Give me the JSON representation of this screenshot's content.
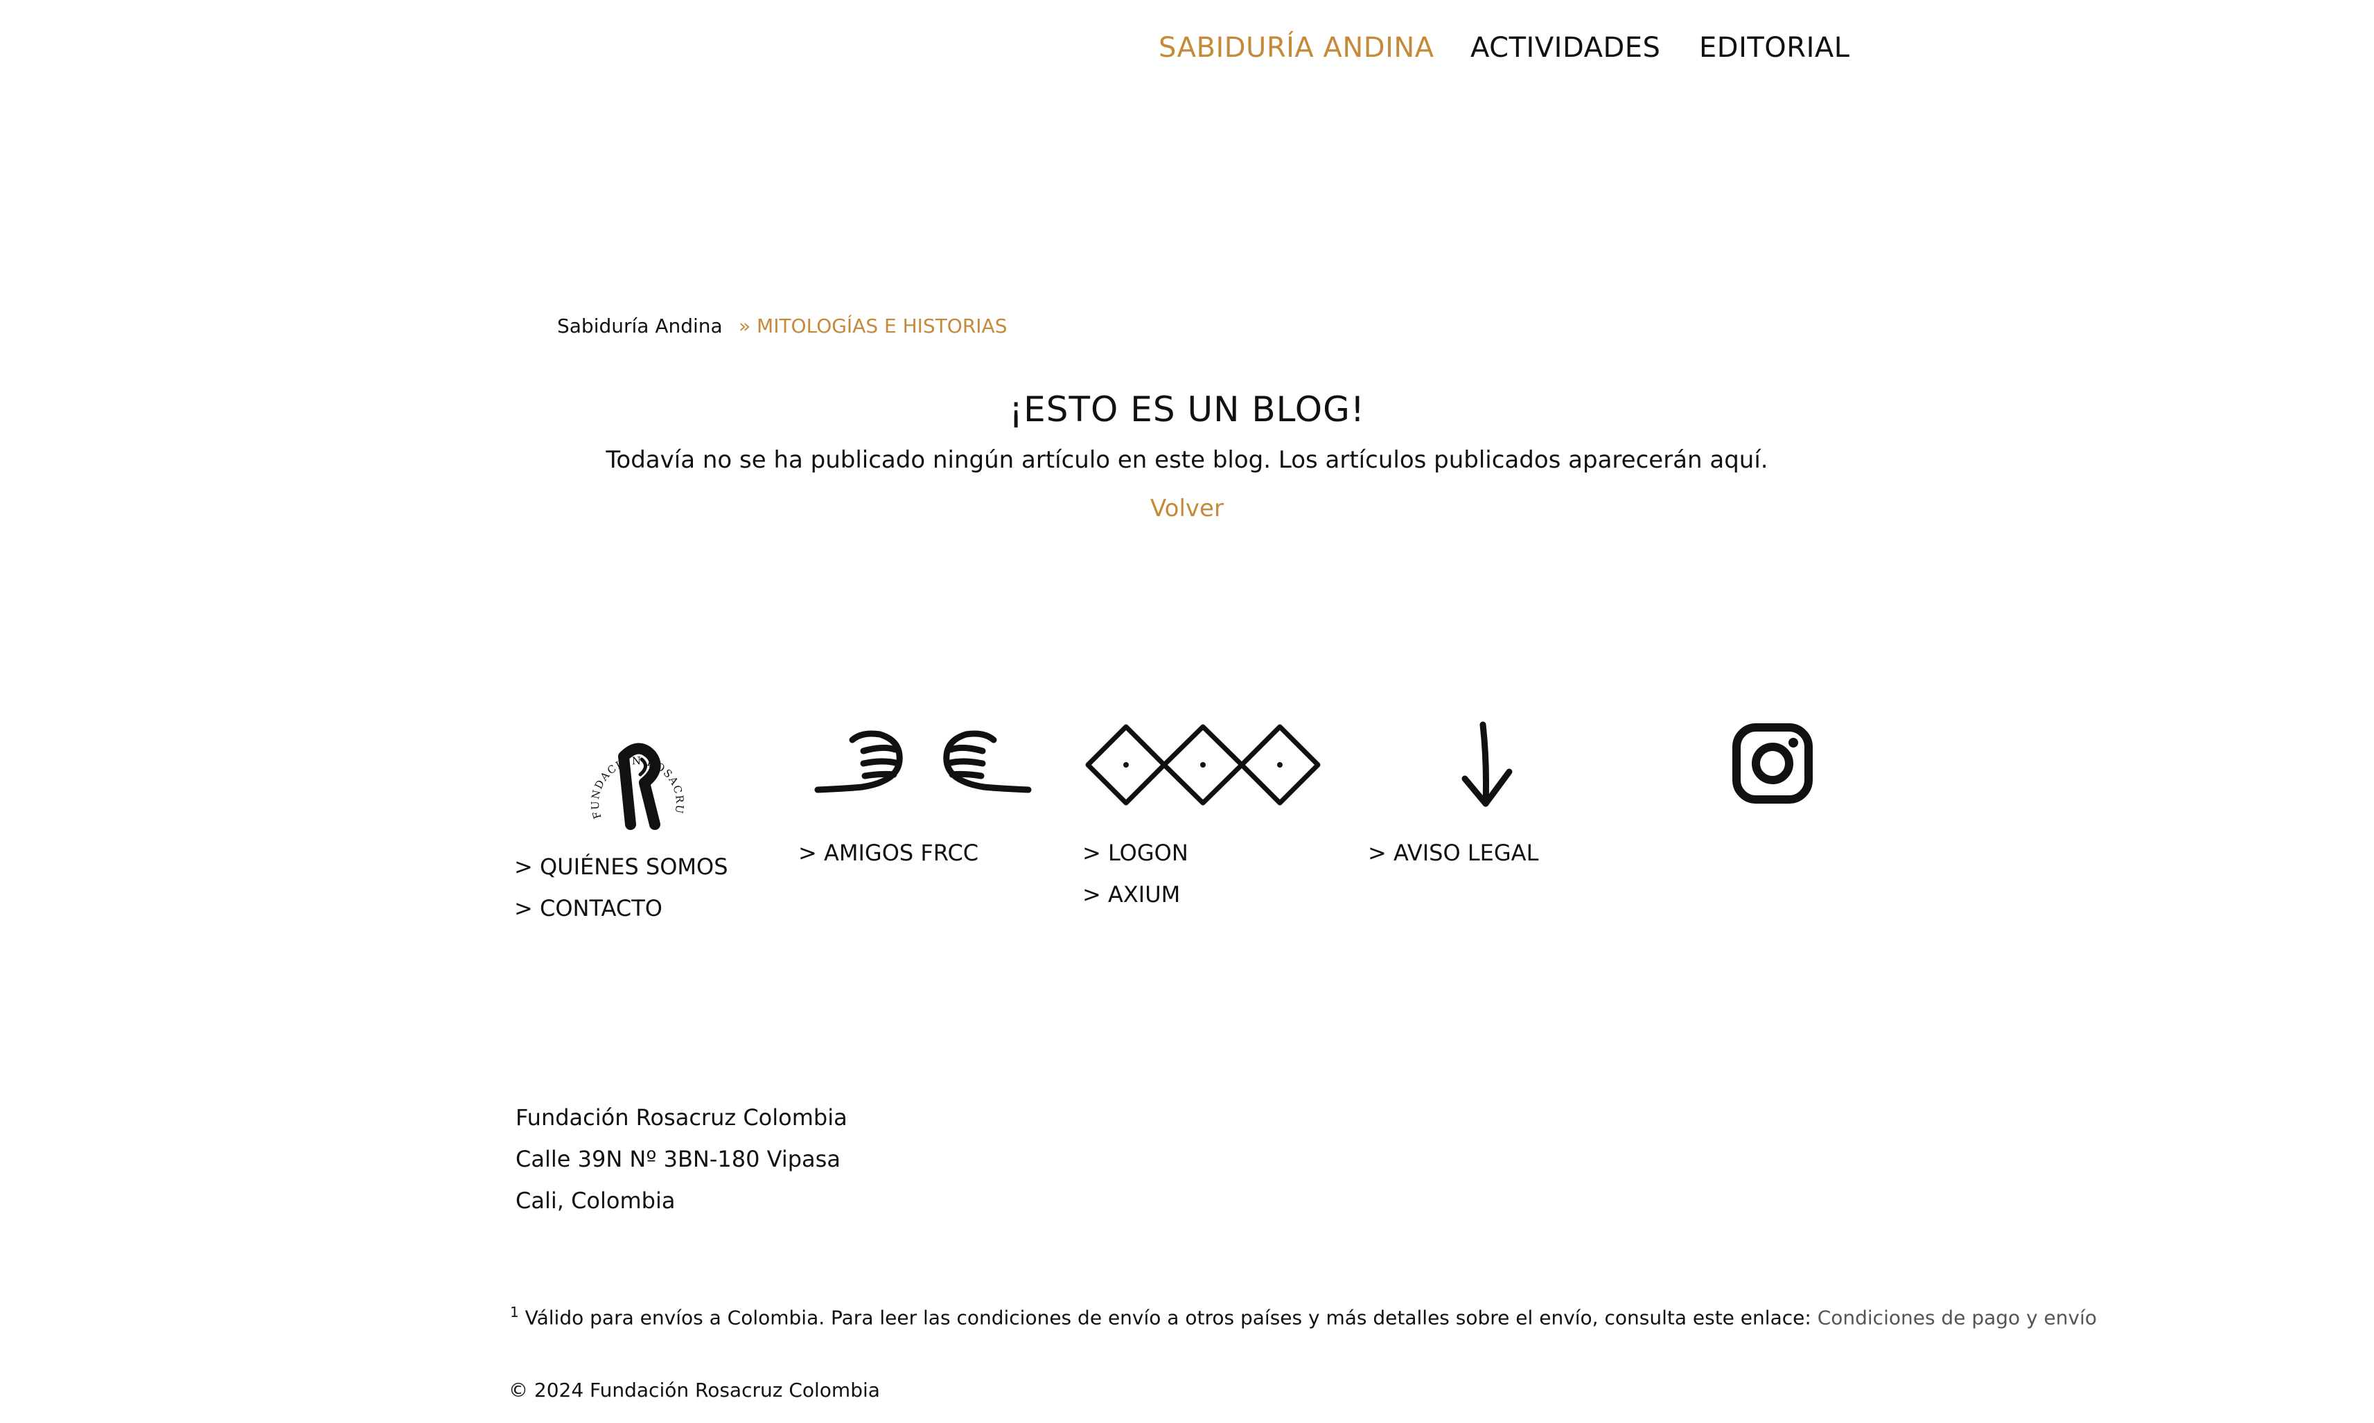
{
  "nav": {
    "items": [
      {
        "label": "SABIDURÍA ANDINA"
      },
      {
        "label": "ACTIVIDADES"
      },
      {
        "label": "EDITORIAL"
      }
    ]
  },
  "breadcrumb": {
    "parent": "Sabiduría Andina",
    "current": "» MITOLOGÍAS E HISTORIAS"
  },
  "blog": {
    "title": "¡ESTO ES UN BLOG!",
    "message": "Todavía no se ha publicado ningún artículo en este blog. Los artículos publicados aparecerán aquí.",
    "back_link": "Volver"
  },
  "footer": {
    "logo_text": "FUNDACIÓN ROSACRUZ COLOMBIA",
    "col1": {
      "links": [
        "> QUIÉNES SOMOS",
        "> CONTACTO"
      ]
    },
    "col2": {
      "links": [
        "> AMIGOS FRCC"
      ]
    },
    "col3": {
      "links": [
        "> LOGON",
        "> AXIUM"
      ]
    },
    "col4": {
      "links": [
        "> AVISO LEGAL"
      ]
    },
    "social": {
      "icon": "instagram-icon"
    },
    "address": {
      "line1": "Fundación Rosacruz Colombia",
      "line2": "Calle 39N Nº 3BN-180 Vipasa",
      "line3": "Cali, Colombia"
    },
    "footnote": {
      "mark": "1",
      "text": "Válido para envíos a Colombia. Para leer las condiciones de envío a otros países y más detalles sobre el envío, consulta este enlace: ",
      "link": "Condiciones de pago y envío"
    },
    "copyright": "© 2024 Fundación Rosacruz Colombia"
  },
  "colors": {
    "accent": "#c48a3a",
    "text": "#111111",
    "background": "#ffffff"
  }
}
